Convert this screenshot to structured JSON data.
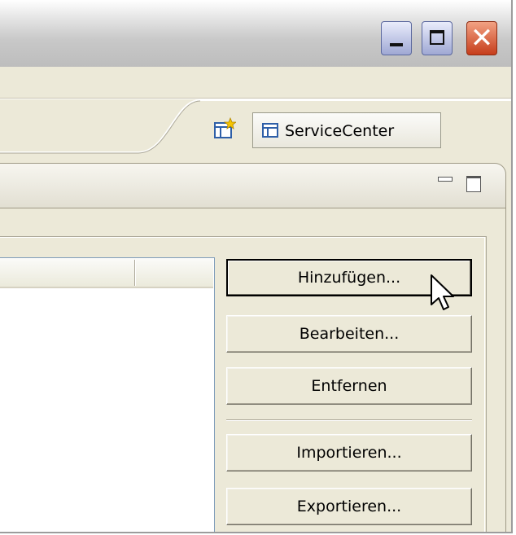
{
  "window": {
    "minimize_icon": "minimize-icon",
    "maximize_icon": "maximize-icon",
    "close_icon": "close-icon",
    "close_color": "#d9542f"
  },
  "perspective_bar": {
    "open_perspective_icon": "open-perspective-icon",
    "active_perspective_label": "ServiceCenter",
    "active_perspective_icon": "table-icon"
  },
  "view": {
    "minimize_icon": "view-minimize-icon",
    "maximize_icon": "view-maximize-icon"
  },
  "table": {
    "columns": [
      "",
      ""
    ]
  },
  "buttons": {
    "add": "Hinzufügen...",
    "edit": "Bearbeiten...",
    "remove": "Entfernen",
    "import": "Importieren...",
    "export": "Exportieren..."
  },
  "pointer": "mouse-pointer-icon"
}
